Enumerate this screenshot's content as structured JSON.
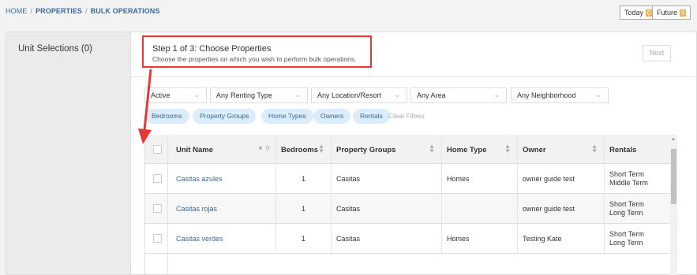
{
  "breadcrumb": {
    "home": "HOME",
    "properties": "PROPERTIES",
    "current": "BULK OPERATIONS",
    "sep": "/"
  },
  "top_buttons": {
    "today_label": "Today",
    "today_count": "0",
    "future_label": "Future",
    "future_count": "0"
  },
  "left_panel": {
    "title": "Unit Selections (0)"
  },
  "step": {
    "title": "Step 1 of 3: Choose Properties",
    "subtitle": "Choose the properties on which you wish to perform bulk operations.",
    "next_label": "Next"
  },
  "filters": [
    {
      "value": "Active"
    },
    {
      "value": "Any Renting Type"
    },
    {
      "value": "Any Location/Resort"
    },
    {
      "value": "Any Area"
    },
    {
      "value": "Any Neighborhood"
    }
  ],
  "pills": [
    "Bedrooms",
    "Property Groups",
    "Home Types",
    "Owners",
    "Rentals"
  ],
  "clear_filters": "Clear Filters",
  "table": {
    "headers": [
      "Unit Name",
      "Bedrooms",
      "Property Groups",
      "Home Type",
      "Owner",
      "Rentals"
    ],
    "rows": [
      {
        "unit": "Casitas azules",
        "bedrooms": "1",
        "group": "Casitas",
        "home_type": "Homes",
        "owner": "owner guide test",
        "rentals": [
          "Short Term",
          "Middle Term"
        ]
      },
      {
        "unit": "Casitas rojas",
        "bedrooms": "1",
        "group": "Casitas",
        "home_type": "",
        "owner": "owner guide test",
        "rentals": [
          "Short Term",
          "Long Term"
        ]
      },
      {
        "unit": "Casitas verdes",
        "bedrooms": "1",
        "group": "Casitas",
        "home_type": "Homes",
        "owner": "Testing Kate",
        "rentals": [
          "Short Term",
          "Long Term"
        ]
      }
    ]
  },
  "colors": {
    "accent": "#3a6a9b",
    "annotation": "#e53935",
    "badge": "#f0b04e",
    "pill_bg": "#dbecfa"
  },
  "icons": {
    "chevron": "chevron-down-icon",
    "sort": "sort-icon",
    "filter": "filter-icon",
    "search": "search-icon"
  }
}
